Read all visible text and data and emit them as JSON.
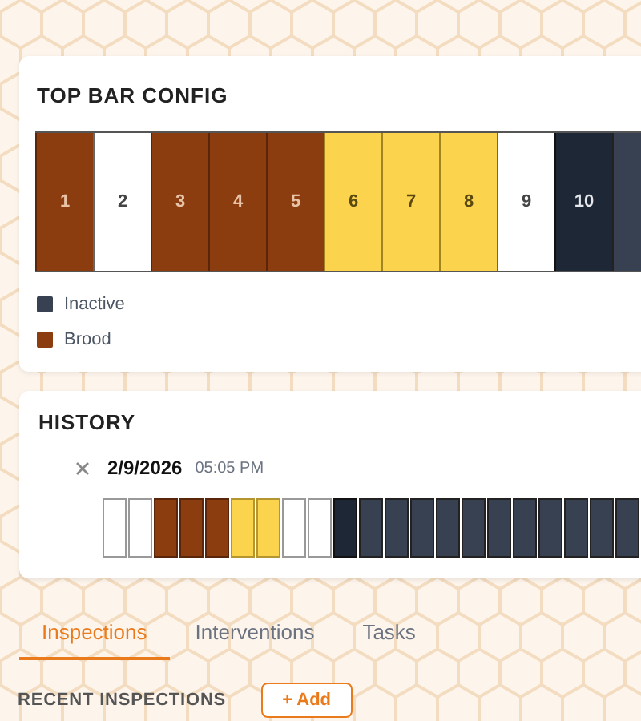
{
  "top_bar_config": {
    "title": "TOP BAR CONFIG",
    "bars": [
      {
        "label": "1",
        "kind": "brood"
      },
      {
        "label": "2",
        "kind": "empty"
      },
      {
        "label": "3",
        "kind": "brood"
      },
      {
        "label": "4",
        "kind": "brood"
      },
      {
        "label": "5",
        "kind": "brood"
      },
      {
        "label": "6",
        "kind": "honey"
      },
      {
        "label": "7",
        "kind": "honey"
      },
      {
        "label": "8",
        "kind": "honey"
      },
      {
        "label": "9",
        "kind": "empty"
      },
      {
        "label": "10",
        "kind": "divider"
      },
      {
        "kind": "inactive"
      }
    ],
    "legend": [
      {
        "label": "Inactive",
        "color": "#374151"
      },
      {
        "label": "Brood",
        "color": "#8b3d0f"
      }
    ]
  },
  "history": {
    "title": "HISTORY",
    "entries": [
      {
        "date": "2/9/2026",
        "time": "05:05 PM",
        "cells": [
          {
            "kind": "empty"
          },
          {
            "kind": "empty"
          },
          {
            "kind": "brood"
          },
          {
            "kind": "brood"
          },
          {
            "kind": "brood"
          },
          {
            "kind": "honey"
          },
          {
            "kind": "honey"
          },
          {
            "kind": "empty"
          },
          {
            "kind": "empty"
          },
          {
            "kind": "divider"
          },
          {
            "kind": "inactive"
          },
          {
            "kind": "inactive"
          },
          {
            "kind": "inactive"
          },
          {
            "kind": "inactive"
          },
          {
            "kind": "inactive"
          },
          {
            "kind": "inactive"
          },
          {
            "kind": "inactive"
          },
          {
            "kind": "inactive"
          },
          {
            "kind": "inactive"
          },
          {
            "kind": "inactive"
          },
          {
            "kind": "inactive"
          }
        ]
      }
    ]
  },
  "tabs": [
    {
      "label": "Inspections",
      "selected": true
    },
    {
      "label": "Interventions",
      "selected": false
    },
    {
      "label": "Tasks",
      "selected": false
    }
  ],
  "section": {
    "title": "RECENT INSPECTIONS",
    "button": "+ Add"
  }
}
